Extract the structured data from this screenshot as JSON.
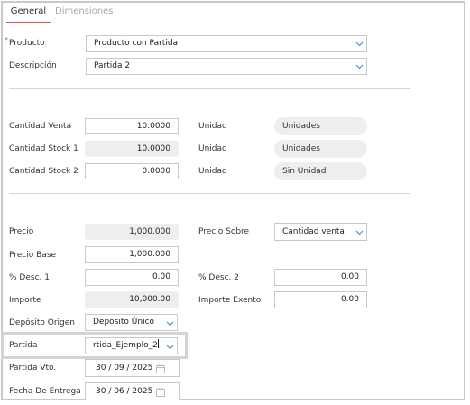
{
  "tabs": [
    {
      "label": "General"
    },
    {
      "label": "Dimensiones"
    }
  ],
  "fields": {
    "producto": {
      "label": "Producto",
      "value": "Producto con Partida"
    },
    "descripcion": {
      "label": "Descripción",
      "value": "Partida 2"
    },
    "cantidad_venta": {
      "label": "Cantidad Venta",
      "value": "10.0000",
      "unit_label": "Unidad",
      "unit_value": "Unidades"
    },
    "cantidad_stock1": {
      "label": "Cantidad Stock 1",
      "value": "10.0000",
      "unit_label": "Unidad",
      "unit_value": "Unidades"
    },
    "cantidad_stock2": {
      "label": "Cantidad Stock 2",
      "value": "0.0000",
      "unit_label": "Unidad",
      "unit_value": "Sin Unidad"
    },
    "precio": {
      "label": "Precio",
      "value": "1,000.000"
    },
    "precio_sobre": {
      "label": "Precio Sobre",
      "value": "Cantidad venta"
    },
    "precio_base": {
      "label": "Precio Base",
      "value": "1,000.000"
    },
    "desc1": {
      "label": "% Desc. 1",
      "value": "0.00"
    },
    "desc2": {
      "label": "% Desc. 2",
      "value": "0.00"
    },
    "importe": {
      "label": "Importe",
      "value": "10,000.00"
    },
    "importe_exento": {
      "label": "Importe Exento",
      "value": "0.00"
    },
    "deposito": {
      "label": "Depósito Origen",
      "value": "Deposito Único"
    },
    "partida": {
      "label": "Partida",
      "value": "rtida_Ejemplo_2"
    },
    "partida_vto": {
      "label": "Partida Vto.",
      "value": "30 / 09 / 2025"
    },
    "fecha_entrega": {
      "label": "Fecha De Entrega",
      "value": "30 / 06 / 2025"
    }
  },
  "icons": {
    "dropdown": "chevron-down-icon",
    "date": "calendar-icon"
  },
  "colors": {
    "accent": "#d9534f",
    "chevron": "#5b8fc7",
    "readonly_bg": "#eeeeee"
  }
}
